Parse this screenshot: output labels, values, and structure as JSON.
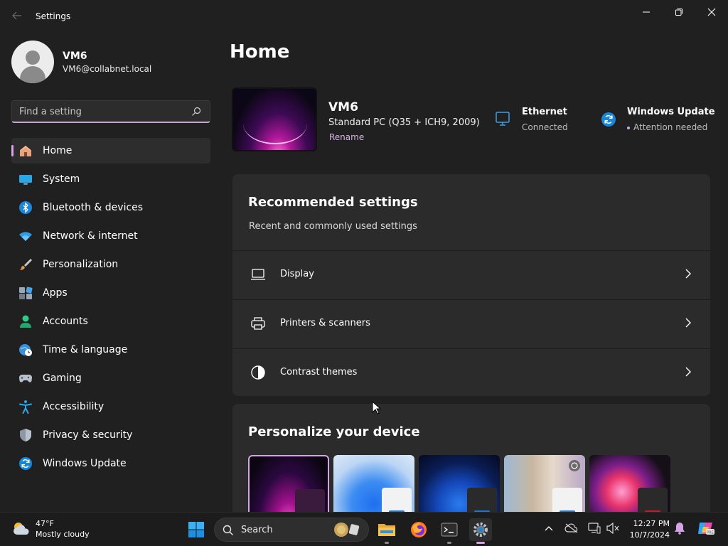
{
  "window": {
    "title": "Settings"
  },
  "profile": {
    "name": "VM6",
    "email": "VM6@collabnet.local"
  },
  "search": {
    "placeholder": "Find a setting"
  },
  "sidebar": {
    "items": [
      {
        "label": "Home",
        "icon": "home-icon",
        "active": true
      },
      {
        "label": "System",
        "icon": "system-icon"
      },
      {
        "label": "Bluetooth & devices",
        "icon": "bluetooth-icon"
      },
      {
        "label": "Network & internet",
        "icon": "wifi-icon"
      },
      {
        "label": "Personalization",
        "icon": "brush-icon"
      },
      {
        "label": "Apps",
        "icon": "apps-icon"
      },
      {
        "label": "Accounts",
        "icon": "accounts-icon"
      },
      {
        "label": "Time & language",
        "icon": "globe-clock-icon"
      },
      {
        "label": "Gaming",
        "icon": "gamepad-icon"
      },
      {
        "label": "Accessibility",
        "icon": "accessibility-icon"
      },
      {
        "label": "Privacy & security",
        "icon": "shield-icon"
      },
      {
        "label": "Windows Update",
        "icon": "update-icon"
      }
    ]
  },
  "main": {
    "title": "Home",
    "device": {
      "name": "VM6",
      "model": "Standard PC (Q35 + ICH9, 2009)",
      "rename": "Rename"
    },
    "ethernet": {
      "title": "Ethernet",
      "status": "Connected"
    },
    "update": {
      "title": "Windows Update",
      "status": "Attention needed"
    },
    "recommended": {
      "title": "Recommended settings",
      "subtitle": "Recent and commonly used settings",
      "items": [
        {
          "label": "Display",
          "icon": "display-icon"
        },
        {
          "label": "Printers & scanners",
          "icon": "printer-icon"
        },
        {
          "label": "Contrast themes",
          "icon": "contrast-icon"
        }
      ]
    },
    "personalize": {
      "title": "Personalize your device"
    }
  },
  "taskbar": {
    "weather": {
      "temp": "47°F",
      "condition": "Mostly cloudy"
    },
    "search_label": "Search",
    "clock": {
      "time": "12:27 PM",
      "date": "10/7/2024"
    }
  },
  "colors": {
    "accent": "#d6a3e6",
    "background": "#202020",
    "card": "#2b2b2b"
  }
}
